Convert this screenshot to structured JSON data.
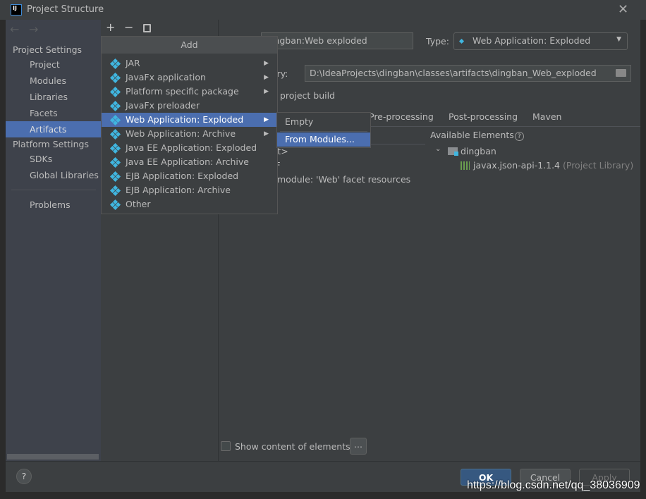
{
  "window": {
    "title": "Project Structure",
    "logo": "IJ"
  },
  "sidebar": {
    "project_settings": "Project Settings",
    "items": [
      "Project",
      "Modules",
      "Libraries",
      "Facets",
      "Artifacts"
    ],
    "platform_settings": "Platform Settings",
    "platform_items": [
      "SDKs",
      "Global Libraries"
    ],
    "problems": "Problems",
    "selected": "Artifacts"
  },
  "toolbar": {
    "add": "+",
    "remove": "−"
  },
  "artifact": {
    "name": "dingban:Web exploded",
    "type_label": "Type:",
    "type_value": "Web Application: Exploded",
    "output_label": "tory:",
    "output_path": "D:\\IdeaProjects\\dingban\\classes\\artifacts\\dingban_Web_exploded",
    "build_label": "n project build",
    "tabs": [
      "Pre-processing",
      "Post-processing",
      "Maven"
    ],
    "tree": [
      "oot>",
      "NF",
      "an' module: 'Web' facet resources"
    ],
    "available_label": "Available Elements",
    "available_root": "dingban",
    "available_lib": "javax.json-api-1.1.4",
    "available_lib_suffix": "(Project Library)",
    "show_content": "Show content of elements",
    "more": "..."
  },
  "popup": {
    "title": "Add",
    "items": [
      {
        "label": "JAR",
        "submenu": true,
        "icon": "artifact-icon"
      },
      {
        "label": "JavaFx application",
        "submenu": true,
        "icon": "artifact-icon"
      },
      {
        "label": "Platform specific package",
        "submenu": true,
        "icon": "artifact-icon"
      },
      {
        "label": "JavaFx preloader",
        "submenu": false,
        "icon": "artifact-icon"
      },
      {
        "label": "Web Application: Exploded",
        "submenu": true,
        "icon": "web-artifact-icon",
        "selected": true
      },
      {
        "label": "Web Application: Archive",
        "submenu": true,
        "icon": "web-artifact-icon"
      },
      {
        "label": "Java EE Application: Exploded",
        "submenu": false,
        "icon": "javaee-artifact-icon"
      },
      {
        "label": "Java EE Application: Archive",
        "submenu": false,
        "icon": "javaee-artifact-icon"
      },
      {
        "label": "EJB Application: Exploded",
        "submenu": false,
        "icon": "ejb-artifact-icon"
      },
      {
        "label": "EJB Application: Archive",
        "submenu": false,
        "icon": "ejb-artifact-icon"
      },
      {
        "label": "Other",
        "submenu": false,
        "icon": "artifact-icon"
      }
    ],
    "submenu": [
      "Empty",
      "From Modules..."
    ]
  },
  "footer": {
    "help": "?",
    "ok": "OK",
    "cancel": "Cancel",
    "apply": "Apply"
  },
  "watermark": "https://blog.csdn.net/qq_38036909",
  "colors": {
    "accent": "#4b6eaf",
    "ok": "#365880",
    "icon": "#40b6e0"
  }
}
